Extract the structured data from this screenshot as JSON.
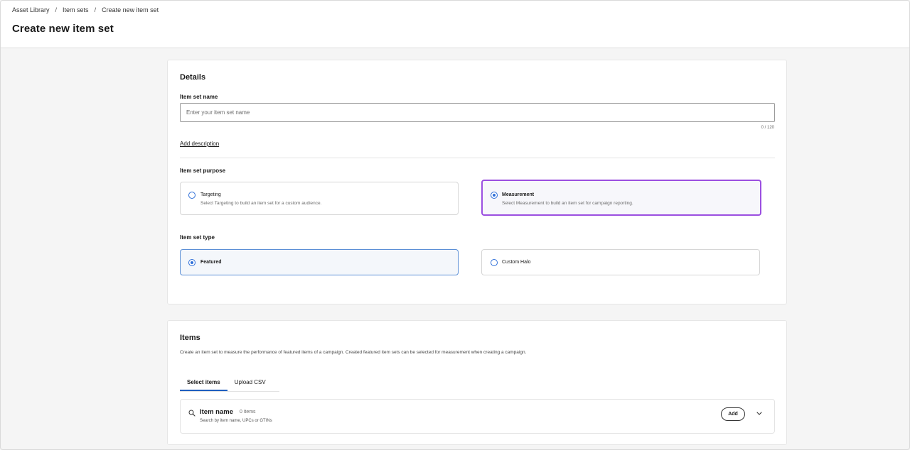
{
  "breadcrumb": [
    {
      "label": "Asset Library"
    },
    {
      "label": "Item sets"
    },
    {
      "label": "Create new item set"
    }
  ],
  "breadcrumb_separator": "/",
  "page_title": "Create new item set",
  "details": {
    "title": "Details",
    "name_label": "Item set name",
    "name_placeholder": "Enter your item set name",
    "name_value": "",
    "char_count": "0 / 120",
    "add_description": "Add description",
    "purpose_label": "Item set purpose",
    "purpose_options": [
      {
        "title": "Targeting",
        "description": "Select Targeting to build an item set for a custom audience.",
        "selected": false
      },
      {
        "title": "Measurement",
        "description": "Select Measurement to build an item set for campaign reporting.",
        "selected": true
      }
    ],
    "type_label": "Item set type",
    "type_options": [
      {
        "title": "Featured",
        "selected": true
      },
      {
        "title": "Custom Halo",
        "selected": false
      }
    ]
  },
  "items": {
    "title": "Items",
    "description": "Create an item set to measure the performance of featured items of a campaign. Created featured item sets can be selected for measurement when creating a campaign.",
    "tabs": [
      {
        "label": "Select items",
        "active": true
      },
      {
        "label": "Upload CSV",
        "active": false
      }
    ],
    "row": {
      "name": "Item name",
      "count": "0 items",
      "hint": "Search by item name, UPCs or GTINs",
      "add_label": "Add"
    }
  },
  "colors": {
    "accent_blue": "#2f6fd8",
    "highlight_purple": "#9b4fe0",
    "tab_underline": "#1f5fbf"
  },
  "icons": [
    "search-icon",
    "chevron-down-icon",
    "radio-icon"
  ]
}
